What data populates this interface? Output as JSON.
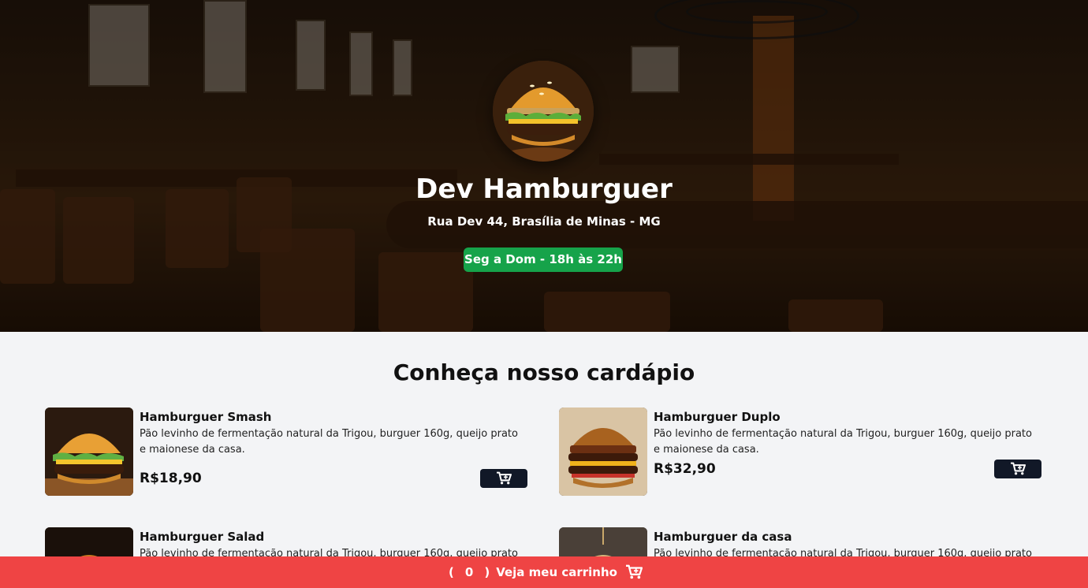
{
  "header": {
    "title": "Dev Hamburguer",
    "address": "Rua Dev 44, Brasília de Minas - MG",
    "hours": "Seg a Dom - 18h às 22h"
  },
  "menu": {
    "title": "Conheça nosso cardápio",
    "items": [
      {
        "name": "Hamburguer Smash",
        "description": "Pão levinho de fermentação natural da Trigou, burguer 160g, queijo prato e maionese da casa.",
        "price": "R$18,90"
      },
      {
        "name": "Hamburguer Duplo",
        "description": "Pão levinho de fermentação natural da Trigou, burguer 160g, queijo prato e maionese da casa.",
        "price": "R$32,90"
      },
      {
        "name": "Hamburguer Salad",
        "description": "Pão levinho de fermentação natural da Trigou, burguer 160g, queijo prato e"
      },
      {
        "name": "Hamburguer da casa",
        "description": "Pão levinho de fermentação natural da Trigou, burguer 160g, queijo prato e"
      }
    ]
  },
  "cart": {
    "open_paren": "(",
    "count": "0",
    "close_paren": ")",
    "label": "Veja meu carrinho",
    "icon": "cart-plus-icon"
  },
  "colors": {
    "hours_badge": "#16a34a",
    "cart_bar": "#ef4444",
    "cart_button": "#111827"
  }
}
